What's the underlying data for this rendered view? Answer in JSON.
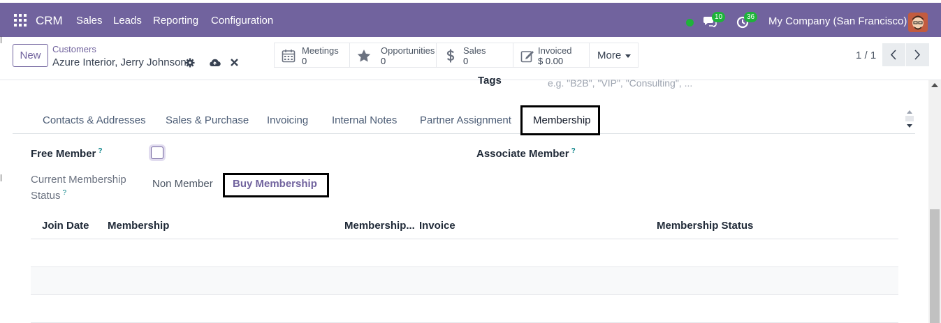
{
  "navbar": {
    "brand": "CRM",
    "menu": [
      "Sales",
      "Leads",
      "Reporting",
      "Configuration"
    ],
    "chat_count": "10",
    "activity_count": "36",
    "company": "My Company (San Francisco)",
    "color": "#71639e"
  },
  "control": {
    "new_label": "New",
    "breadcrumb_parent": "Customers",
    "breadcrumb_current": "Azure Interior, Jerry Johnson",
    "stats": [
      {
        "label": "Meetings",
        "value": "0",
        "icon": "calendar-icon"
      },
      {
        "label": "Opportunities",
        "value": "0",
        "icon": "star-icon"
      },
      {
        "label": "Sales",
        "value": "0",
        "icon": "dollar-icon"
      },
      {
        "label": "Invoiced",
        "value": "$ 0.00",
        "icon": "invoice-edit-icon"
      }
    ],
    "more_label": "More",
    "pager": "1 / 1"
  },
  "form": {
    "tags_label": "Tags",
    "tags_placeholder": "e.g. \"B2B\", \"VIP\", \"Consulting\", ...",
    "tabs": [
      "Contacts & Addresses",
      "Sales & Purchase",
      "Invoicing",
      "Internal Notes",
      "Partner Assignment",
      "Membership"
    ],
    "active_tab": "Membership",
    "free_member_label": "Free Member",
    "associate_member_label": "Associate Member",
    "current_status_label_1": "Current Membership",
    "current_status_label_2": "Status",
    "current_status_value": "Non Member",
    "buy_membership_label": "Buy Membership",
    "help_mark": "?",
    "table_headers": [
      "Join Date",
      "Membership",
      "Membership...",
      "Invoice",
      "Membership Status"
    ]
  }
}
